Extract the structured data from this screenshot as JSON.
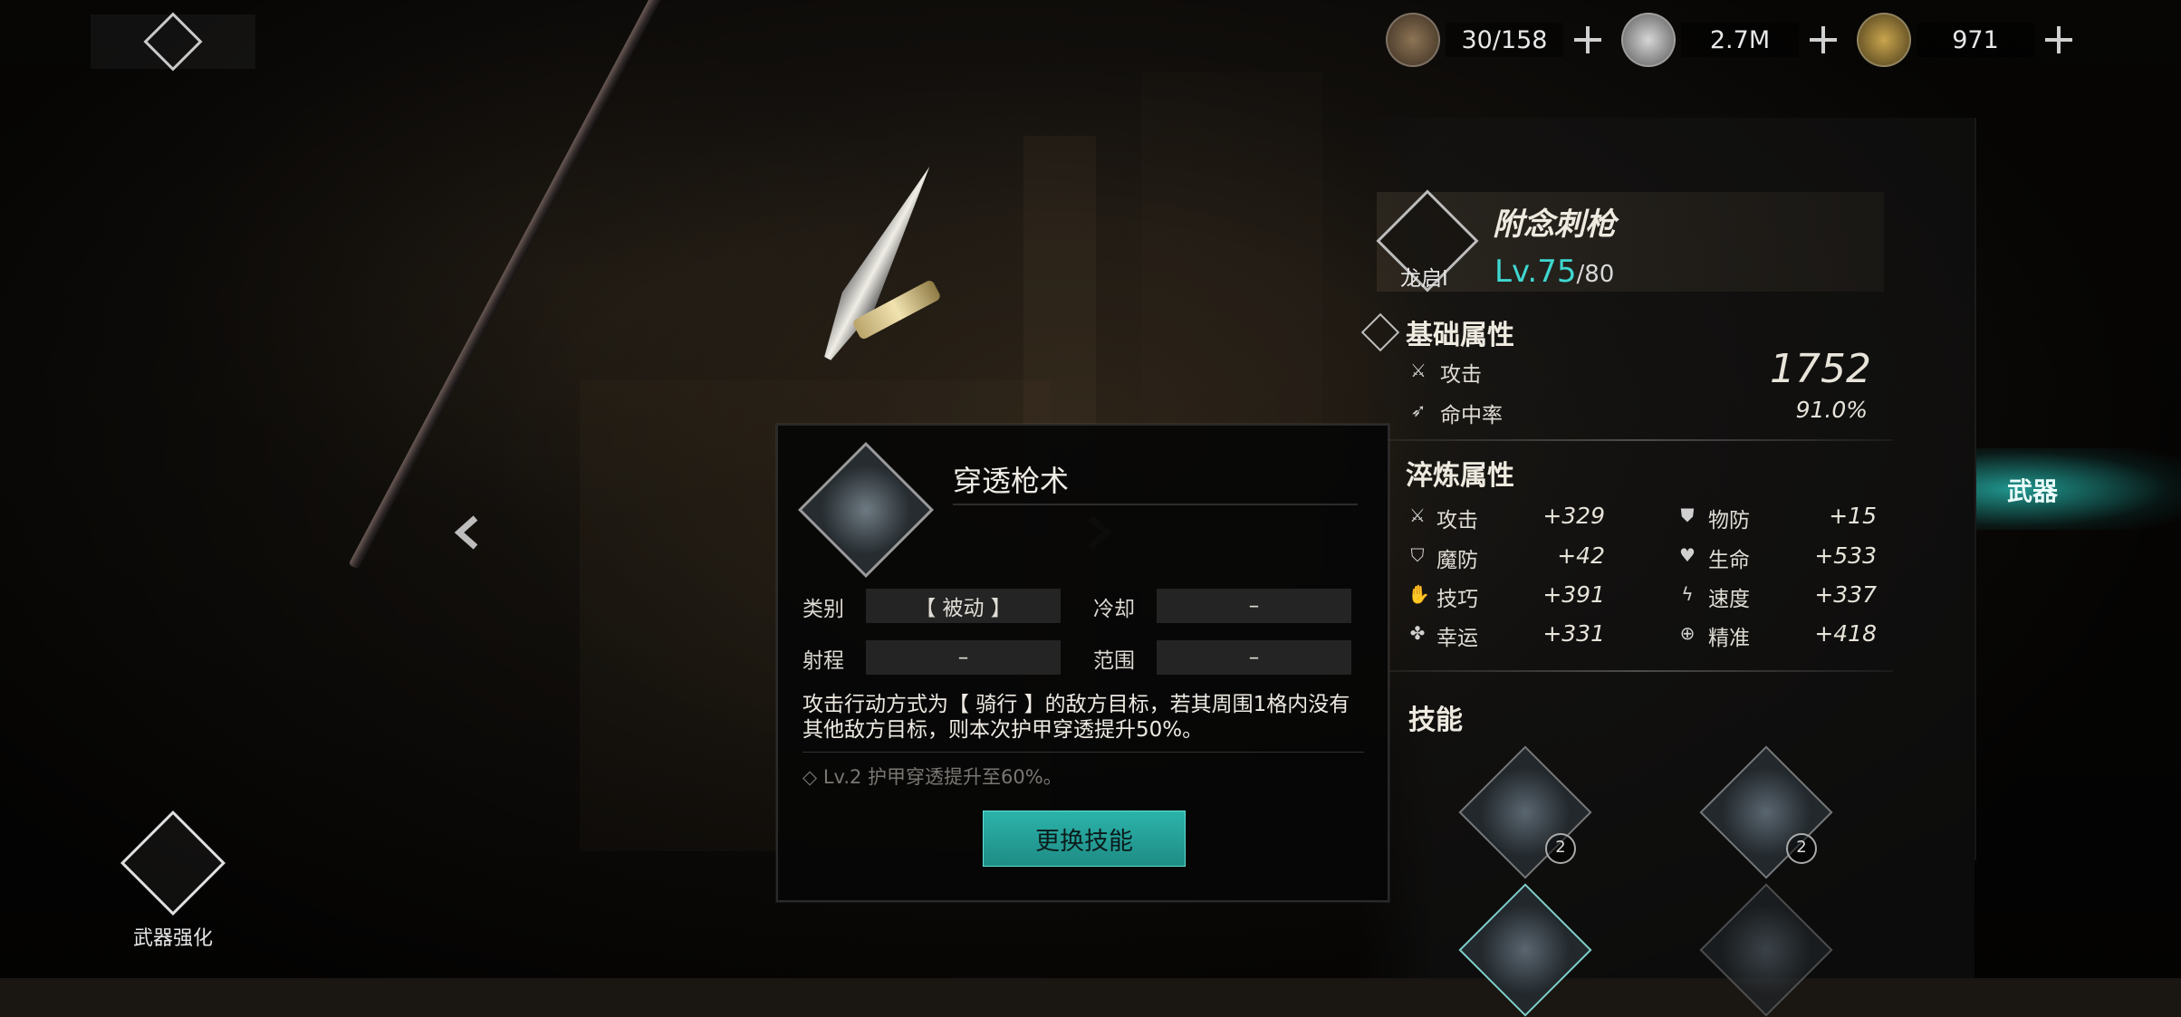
{
  "currencies": [
    {
      "icon": "wood-resource-icon",
      "value": "30/158"
    },
    {
      "icon": "silver-coin-icon",
      "value": "2.7M"
    },
    {
      "icon": "gold-feather-icon",
      "value": "971"
    }
  ],
  "enhance": {
    "label": "武器强化"
  },
  "weapon": {
    "name": "附念刺枪",
    "class": "龙启I",
    "level": "Lv.75",
    "max_level": "/80"
  },
  "base_stats": {
    "title": "基础属性",
    "items": [
      {
        "icon": "crossed-swords-icon",
        "label": "攻击",
        "value": "1752"
      },
      {
        "icon": "accuracy-icon",
        "label": "命中率",
        "value": "91.0%"
      }
    ]
  },
  "refine_stats": {
    "title": "淬炼属性",
    "items": [
      {
        "icon": "crossed-swords-icon",
        "label": "攻击",
        "value": "+329"
      },
      {
        "icon": "shield-icon",
        "label": "物防",
        "value": "+15"
      },
      {
        "icon": "magic-shield-icon",
        "label": "魔防",
        "value": "+42"
      },
      {
        "icon": "heart-icon",
        "label": "生命",
        "value": "+533"
      },
      {
        "icon": "skill-icon",
        "label": "技巧",
        "value": "+391"
      },
      {
        "icon": "lightning-icon",
        "label": "速度",
        "value": "+337"
      },
      {
        "icon": "clover-icon",
        "label": "幸运",
        "value": "+331"
      },
      {
        "icon": "target-icon",
        "label": "精准",
        "value": "+418"
      }
    ]
  },
  "skills": {
    "title": "技能",
    "badges": [
      "2",
      "2"
    ]
  },
  "tab": {
    "label": "武器"
  },
  "popup": {
    "title": "穿透枪术",
    "type_label": "类别",
    "type_value": "【 被动 】",
    "cooldown_label": "冷却",
    "cooldown_value": "–",
    "range_label": "射程",
    "range_value": "–",
    "area_label": "范围",
    "area_value": "–",
    "description": "攻击行动方式为【 骑行 】的敌方目标，若其周围1格内没有其他敌方目标，则本次护甲穿透提升50%。",
    "upgrade": "Lv.2 护甲穿透提升至60%。",
    "button": "更换技能"
  },
  "colors": {
    "accent": "#2cb3aa",
    "level": "#3fd7d0"
  }
}
